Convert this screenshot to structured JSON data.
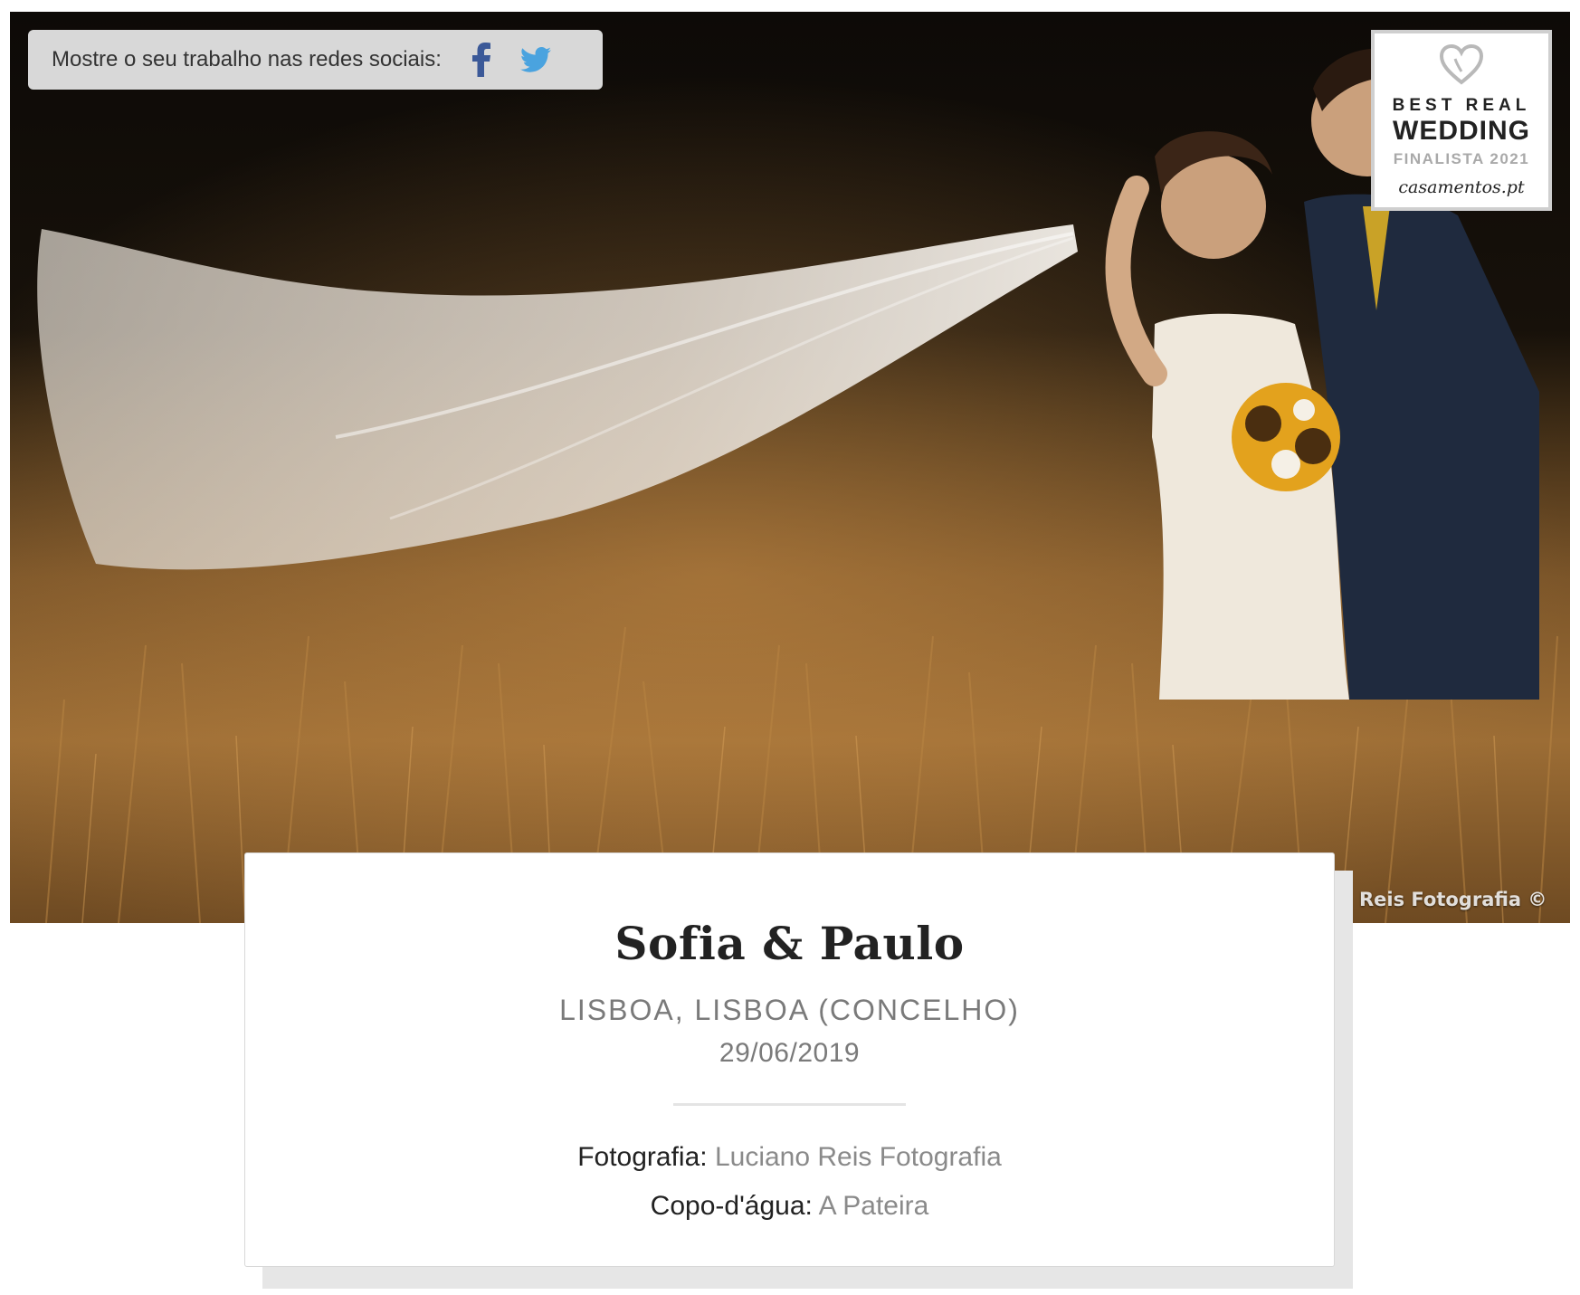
{
  "share": {
    "label": "Mostre o seu trabalho nas redes sociais:",
    "icons": [
      "facebook-icon",
      "twitter-icon"
    ],
    "facebook_color": "#3b5998",
    "twitter_color": "#4aa3df"
  },
  "badge": {
    "line1": "BEST REAL",
    "line2": "WEDDING",
    "line3": "FINALISTA 2021",
    "line4": "casamentos.pt"
  },
  "photo_credit": "Reis Fotografia ©",
  "wedding": {
    "names": "Sofia & Paulo",
    "location": "LISBOA, LISBOA (CONCELHO)",
    "date": "29/06/2019",
    "details": [
      {
        "label": "Fotografia:",
        "value": "Luciano Reis Fotografia"
      },
      {
        "label": "Copo-d'água:",
        "value": "A Pateira"
      }
    ]
  }
}
